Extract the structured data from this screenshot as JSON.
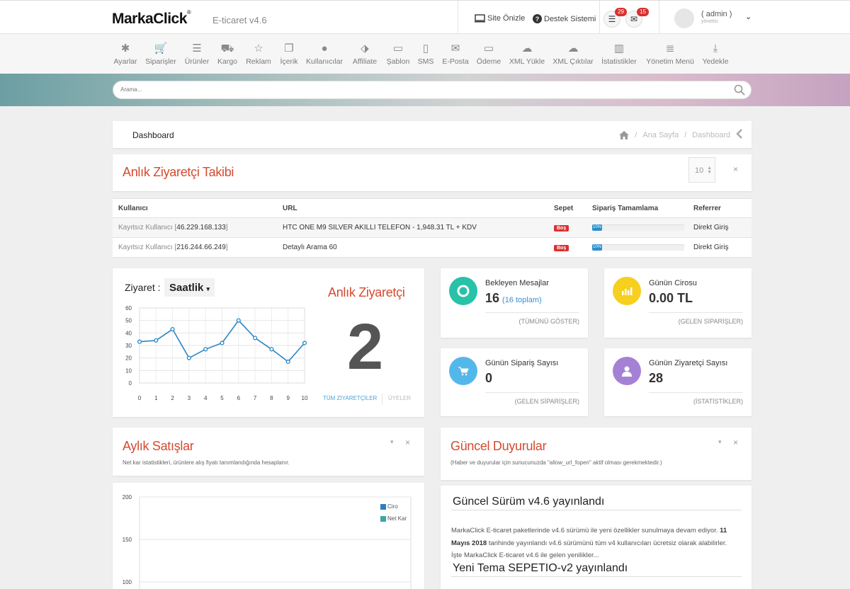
{
  "header": {
    "logo": "MarkaClick",
    "logo_mark": "®",
    "version": "E-ticaret v4.6",
    "site_preview": "Site Önizle",
    "support": "Destek Sistemi",
    "orders_badge": "29",
    "messages_badge": "15",
    "user_name": "( admin )",
    "user_role": "yönetici"
  },
  "menu": [
    {
      "label": "Ayarlar",
      "icon": "asterisk-icon"
    },
    {
      "label": "Siparişler",
      "icon": "cart-icon"
    },
    {
      "label": "Ürünler",
      "icon": "list-icon"
    },
    {
      "label": "Kargo",
      "icon": "truck-icon"
    },
    {
      "label": "Reklam",
      "icon": "star-icon"
    },
    {
      "label": "İçerik",
      "icon": "pages-icon"
    },
    {
      "label": "Kullanıcılar",
      "icon": "user-icon"
    },
    {
      "label": "Affiliate",
      "icon": "tag-icon"
    },
    {
      "label": "Şablon",
      "icon": "monitor-icon"
    },
    {
      "label": "SMS",
      "icon": "mobile-icon"
    },
    {
      "label": "E-Posta",
      "icon": "envelope-icon"
    },
    {
      "label": "Ödeme",
      "icon": "credit-card-icon"
    },
    {
      "label": "XML Yükle",
      "icon": "cloud-upload-icon"
    },
    {
      "label": "XML Çıktılar",
      "icon": "cloud-download-icon"
    },
    {
      "label": "İstatistikler",
      "icon": "bar-chart-icon"
    },
    {
      "label": "Yönetim Menü",
      "icon": "server-icon"
    },
    {
      "label": "Yedekle",
      "icon": "download-icon"
    }
  ],
  "search": {
    "placeholder": "Arama..."
  },
  "breadcrumb": {
    "title": "Dashboard",
    "home": "Ana Sayfa",
    "current": "Dashboard"
  },
  "visitor_tracking": {
    "title": "Anlık Ziyaretçi Takibi",
    "page_size": "10",
    "columns": [
      "Kullanıcı",
      "URL",
      "Sepet",
      "Sipariş Tamamlama",
      "Referrer"
    ],
    "rows": [
      {
        "user_prefix": "Kayıtsız Kullanıcı [",
        "ip": "46.229.168.133",
        "user_suffix": "]",
        "url": "HTC ONE M9 SILVER AKILLI TELEFON - 1,948.31 TL + KDV",
        "cart": "Boş",
        "progress": "10%",
        "progress_value": 10,
        "referrer": "Direkt Giriş"
      },
      {
        "user_prefix": "Kayıtsız Kullanıcı [",
        "ip": "216.244.66.249",
        "user_suffix": "]",
        "url": "Detaylı Arama 60",
        "cart": "Boş",
        "progress": "10%",
        "progress_value": 10,
        "referrer": "Direkt Giriş"
      }
    ]
  },
  "visits": {
    "label": "Ziyaret :",
    "period": "Saatlik",
    "live_title": "Anlık Ziyaretçi",
    "live_count": "2",
    "all_visitors": "TÜM ZİYARETÇİLER",
    "members": "ÜYELER"
  },
  "chart_data": [
    {
      "type": "line",
      "x": [
        0,
        1,
        2,
        3,
        4,
        5,
        6,
        7,
        8,
        9,
        10
      ],
      "values": [
        33,
        34,
        43,
        20,
        27,
        32,
        50,
        36,
        27,
        17,
        32
      ],
      "ylim": [
        0,
        60
      ],
      "yticks": [
        0,
        10,
        20,
        30,
        40,
        50,
        60
      ],
      "xticks": [
        "0",
        "1",
        "2",
        "3",
        "4",
        "5",
        "6",
        "7",
        "8",
        "9",
        "10"
      ],
      "grid": true,
      "color": "#2a86c4"
    },
    {
      "type": "bar",
      "series": [
        {
          "name": "Ciro",
          "color": "#2a7fc6"
        },
        {
          "name": "Net Kar",
          "color": "#3aa6a6"
        }
      ],
      "yticks": [
        "200",
        "150",
        "100"
      ],
      "grid": true,
      "legend": "top-right"
    }
  ],
  "stats": [
    {
      "title": "Bekleyen Mesajlar",
      "value": "16",
      "sub": "(16 toplam)",
      "footer": "(TÜMÜNÜ GÖSTER)",
      "icon": "life-ring-icon",
      "color": "#27c2a8"
    },
    {
      "title": "Günün Cirosu",
      "value": "0.00 TL",
      "sub": "",
      "footer": "(GELEN SİPARİŞLER)",
      "icon": "bar-chart-icon",
      "color": "#f6cf1f"
    },
    {
      "title": "Günün Sipariş Sayısı",
      "value": "0",
      "sub": "",
      "footer": "(GELEN SİPARİŞLER)",
      "icon": "cart-icon",
      "color": "#54b7ea"
    },
    {
      "title": "Günün Ziyaretçi Sayısı",
      "value": "28",
      "sub": "",
      "footer": "(İSTATİSTİKLER)",
      "icon": "user-icon",
      "color": "#a581d6"
    }
  ],
  "monthly_sales": {
    "title": "Aylık Satışlar",
    "note": "Net kar istatistikleri, ürünlere alış fiyatı tanımlandığında hesaplanır."
  },
  "announcements": {
    "title": "Güncel Duyurular",
    "note": "(Haber ve duyurular için sunucunuzda \"allow_url_fopen\" aktif olması gerekmektedir.)",
    "news1_title": "Güncel Sürüm v4.6 yayınlandı",
    "news1_text_a": "MarkaClick E-ticaret paketlerinde v4.6 sürümü ile yeni özellikler sunulmaya devam ediyor. ",
    "news1_date": "11 Mayıs 2018",
    "news1_text_b": " tarihinde yayınlandı v4.6 sürümünü tüm v4 kullanıcıları ücretsiz olarak alabilirler. İşte MarkaClick E-ticaret v4.6 ile gelen yenilikler...",
    "news2_title": "Yeni Tema SEPETIO-v2 yayınlandı"
  },
  "icons": {
    "monitor": "🖵",
    "question": "?",
    "orders": "☰",
    "mail": "✉",
    "caret": "⌄",
    "search": "⚲",
    "home": "⌂",
    "back": "‹",
    "close": "×",
    "collapse": "▾"
  }
}
